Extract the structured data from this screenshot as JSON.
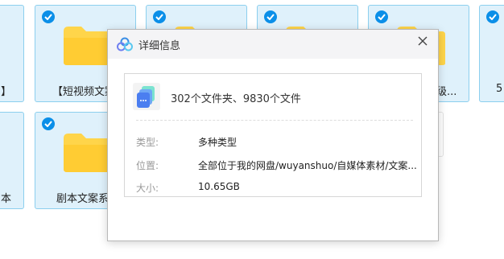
{
  "background": {
    "tiles": [
      {
        "label": "】",
        "checked": true
      },
      {
        "label": "【短视频文案",
        "checked": true
      },
      {
        "label": "",
        "checked": true
      },
      {
        "label": "",
        "checked": true
      },
      {
        "label": "级...",
        "checked": true
      },
      {
        "label": "5",
        "checked": true
      },
      {
        "label": "本",
        "checked": false
      },
      {
        "label": "剧本文案系列",
        "checked": true
      }
    ]
  },
  "dialog": {
    "title": "详细信息",
    "summary": "302个文件夹、9830个文件",
    "rows": [
      {
        "label": "类型:",
        "value": "多种类型"
      },
      {
        "label": "位置:",
        "value": "全部位于我的网盘/wuyanshuo/自媒体素材/文案..."
      },
      {
        "label": "大小:",
        "value": "10.65GB"
      }
    ]
  },
  "colors": {
    "tile_bg": "#dff1fb",
    "tile_border": "#8ccfee",
    "check_blue": "#0b8fe8",
    "folder_yellow": "#ffd54a"
  }
}
